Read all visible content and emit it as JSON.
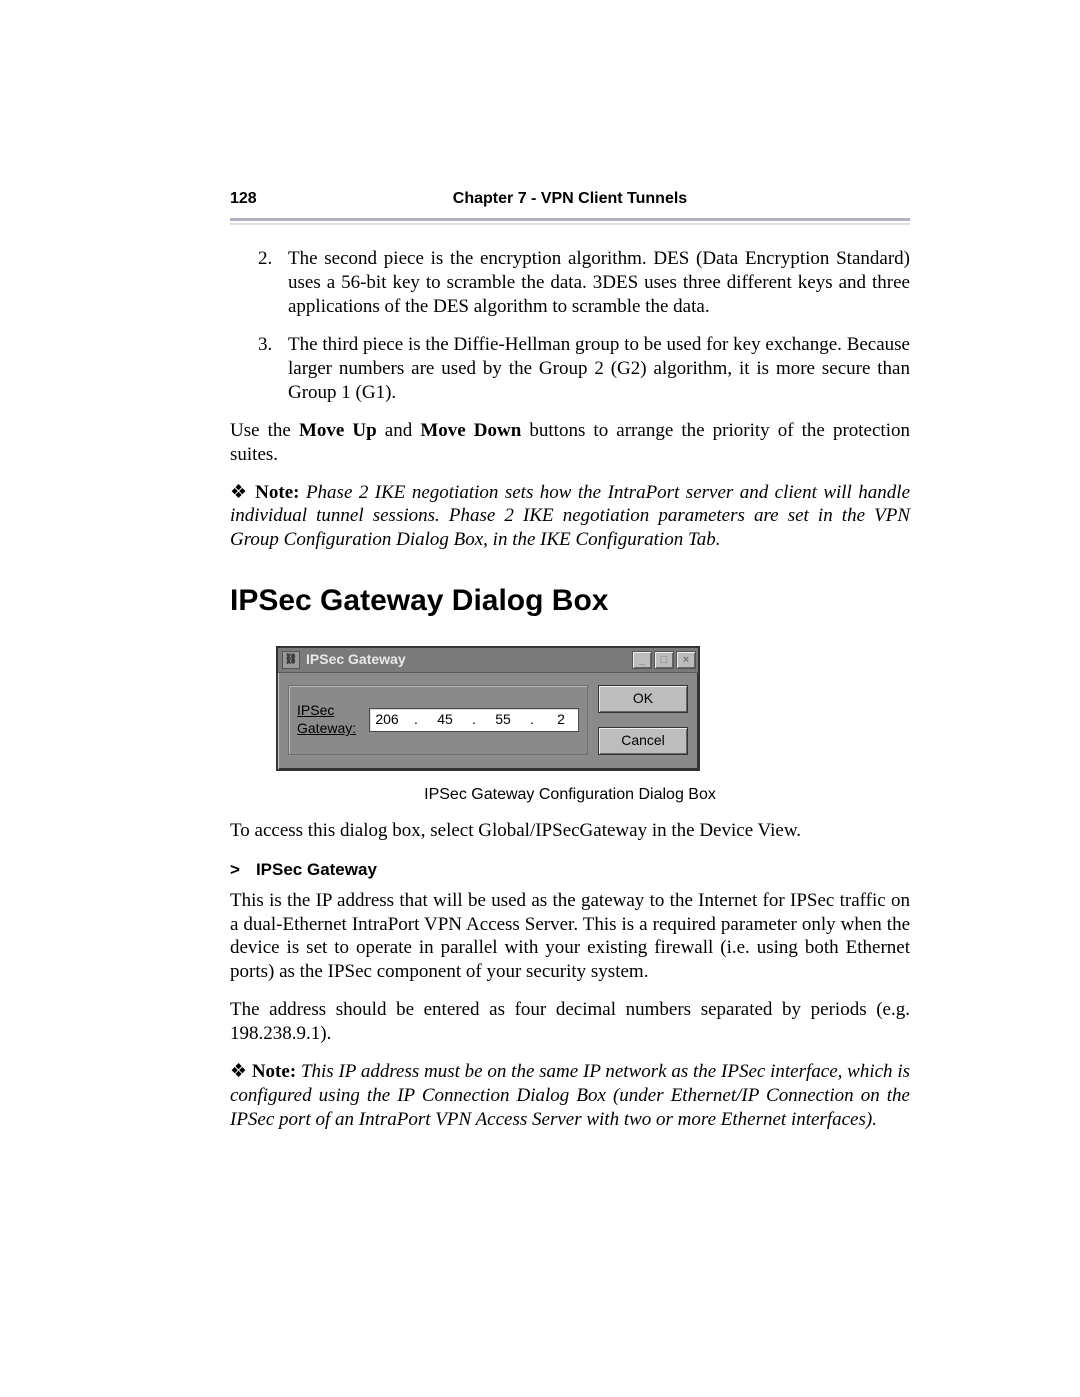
{
  "header": {
    "page_number": "128",
    "chapter_title": "Chapter 7 - VPN Client Tunnels"
  },
  "list": {
    "item2_num": "2.",
    "item2_text": "The second piece is the encryption algorithm. DES (Data Encryption Standard) uses a 56-bit key to scramble the data. 3DES uses three different keys and three applications of the DES algorithm to scramble the data.",
    "item3_num": "3.",
    "item3_text": "The third piece is the Diffie-Hellman group to be used for key exchange. Because larger numbers are used by the Group 2 (G2) algorithm, it is more secure than Group 1 (G1)."
  },
  "moveup_para": {
    "pre": "Use the ",
    "b1": "Move Up",
    "mid": " and ",
    "b2": "Move Down",
    "post": " buttons to arrange the priority of the protection suites."
  },
  "note1": {
    "symbol": "❖",
    "label": " Note:  ",
    "text": "Phase 2 IKE negotiation sets how the IntraPort server and client will handle individual tunnel sessions. Phase 2 IKE negotiation parameters are set in the VPN Group Configuration Dialog Box, in the IKE Configuration Tab."
  },
  "section_heading": "IPSec Gateway Dialog Box",
  "dialog": {
    "title": "IPSec Gateway",
    "label": "IPSec Gateway:",
    "ip": {
      "o1": "206",
      "o2": "45",
      "o3": "55",
      "o4": "2"
    },
    "ok": "OK",
    "cancel": "Cancel",
    "win_min": "_",
    "win_max": "□",
    "win_close": "×"
  },
  "figure_caption": "IPSec Gateway Configuration Dialog Box",
  "access_para": "To access this dialog box, select Global/IPSecGateway in the Device View.",
  "sub_heading": {
    "arrow": ">",
    "text": "IPSec Gateway"
  },
  "gateway_para1": "This is the IP address that will be used as the gateway to the Internet for IPSec traffic on a dual-Ethernet IntraPort VPN Access Server. This is a required parameter only when the device is set to operate in parallel with your existing firewall (i.e. using both Ethernet ports) as the IPSec component of your security system.",
  "gateway_para2": "The address should be entered as four decimal numbers separated by periods (e.g. 198.238.9.1).",
  "note2": {
    "symbol": "❖",
    "label": " Note:  ",
    "text": "This IP address must be on the same IP network as the IPSec interface, which is configured using the IP Connection Dialog Box (under Ethernet/IP Connection on the IPSec port of an IntraPort VPN Access Server with two or more Ethernet interfaces)."
  }
}
